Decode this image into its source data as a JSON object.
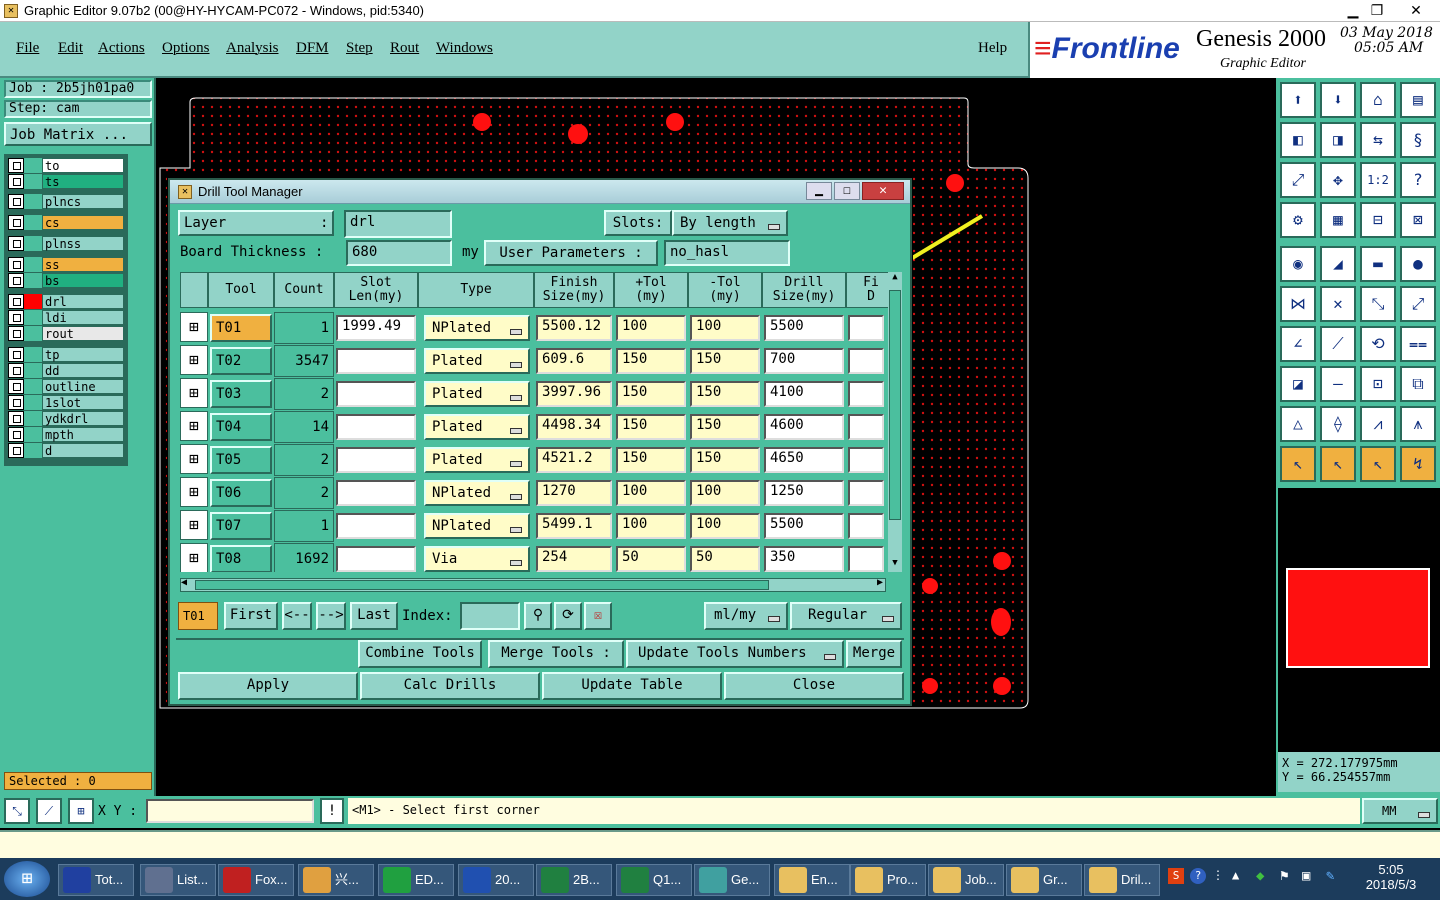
{
  "window": {
    "title": "Graphic Editor 9.07b2 (00@HY-HYCAM-PC072 - Windows, pid:5340)"
  },
  "menu": [
    "File",
    "Edit",
    "Actions",
    "Options",
    "Analysis",
    "DFM",
    "Step",
    "Rout",
    "Windows"
  ],
  "help": "Help",
  "brand": {
    "logo": "Frontline",
    "product": "Genesis 2000",
    "sub": "Graphic Editor",
    "date": "03 May 2018",
    "time": "05:05 AM"
  },
  "left": {
    "job": "Job : 2b5jh01pa0",
    "step": "Step: cam",
    "job_matrix": "Job Matrix ...",
    "selected": "Selected : 0",
    "layers": [
      {
        "name": "to",
        "color": "#ffffff"
      },
      {
        "name": "ts",
        "color": "#20b080"
      },
      {
        "name": "plncs",
        "color": "#92d3c8"
      },
      {
        "name": "cs",
        "color": "#f0b040"
      },
      {
        "name": "plnss",
        "color": "#92d3c8"
      },
      {
        "name": "ss",
        "color": "#f0b040"
      },
      {
        "name": "bs",
        "color": "#20b080"
      },
      {
        "name": "drl",
        "color": "#92d3c8"
      },
      {
        "name": "ldi",
        "color": "#92d3c8"
      },
      {
        "name": "rout",
        "color": "#e8e8e8"
      },
      {
        "name": "tp",
        "color": "#92d3c8"
      },
      {
        "name": "dd",
        "color": "#92d3c8"
      },
      {
        "name": "outline",
        "color": "#92d3c8"
      },
      {
        "name": "1slot",
        "color": "#92d3c8"
      },
      {
        "name": "ydkdrl",
        "color": "#92d3c8"
      },
      {
        "name": "mpth",
        "color": "#92d3c8"
      },
      {
        "name": "d",
        "color": "#92d3c8"
      }
    ]
  },
  "dialog": {
    "title": "Drill Tool Manager",
    "layer_label": "Layer",
    "layer_sep": ":",
    "layer_value": "drl",
    "slots_label": "Slots:",
    "slots_value": "By length",
    "thickness_label": "Board Thickness :",
    "thickness_value": "680",
    "thickness_unit": "my",
    "user_params_label": "User Parameters :",
    "user_params_value": "no_hasl",
    "columns": [
      "Tool",
      "Count",
      "Slot\nLen(my)",
      "Type",
      "Finish\nSize(my)",
      "+Tol\n(my)",
      "-Tol\n(my)",
      "Drill\nSize(my)",
      "Fi\nD"
    ],
    "rows": [
      {
        "tool": "T01",
        "count": "1",
        "slot": "1999.49",
        "type": "NPlated",
        "finish": "5500.12",
        "ptol": "100",
        "ntol": "100",
        "drill": "5500"
      },
      {
        "tool": "T02",
        "count": "3547",
        "slot": "",
        "type": "Plated",
        "finish": "609.6",
        "ptol": "150",
        "ntol": "150",
        "drill": "700"
      },
      {
        "tool": "T03",
        "count": "2",
        "slot": "",
        "type": "Plated",
        "finish": "3997.96",
        "ptol": "150",
        "ntol": "150",
        "drill": "4100"
      },
      {
        "tool": "T04",
        "count": "14",
        "slot": "",
        "type": "Plated",
        "finish": "4498.34",
        "ptol": "150",
        "ntol": "150",
        "drill": "4600"
      },
      {
        "tool": "T05",
        "count": "2",
        "slot": "",
        "type": "Plated",
        "finish": "4521.2",
        "ptol": "150",
        "ntol": "150",
        "drill": "4650"
      },
      {
        "tool": "T06",
        "count": "2",
        "slot": "",
        "type": "NPlated",
        "finish": "1270",
        "ptol": "100",
        "ntol": "100",
        "drill": "1250"
      },
      {
        "tool": "T07",
        "count": "1",
        "slot": "",
        "type": "NPlated",
        "finish": "5499.1",
        "ptol": "100",
        "ntol": "100",
        "drill": "5500"
      },
      {
        "tool": "T08",
        "count": "1692",
        "slot": "",
        "type": "Via",
        "finish": "254",
        "ptol": "50",
        "ntol": "50",
        "drill": "350"
      }
    ],
    "nav": {
      "current": "T01",
      "first": "First",
      "prev": "<--",
      "next": "-->",
      "last": "Last",
      "index": "Index:",
      "units": "ml/my",
      "mode": "Regular"
    },
    "actions": {
      "combine": "Combine Tools",
      "merge_tools": "Merge Tools :",
      "update_numbers": "Update Tools Numbers",
      "merge": "Merge"
    },
    "buttons": {
      "apply": "Apply",
      "calc": "Calc Drills",
      "update": "Update Table",
      "close": "Close"
    }
  },
  "coords": {
    "x": "X = 272.177975mm",
    "y": "Y = 66.254557mm"
  },
  "cmd": {
    "xy": "X Y :",
    "message": "<M1> - Select first corner",
    "unit": "MM"
  },
  "taskbar": {
    "items": [
      {
        "label": "Tot...",
        "color": "#2040a0"
      },
      {
        "label": "List...",
        "color": "#607090"
      },
      {
        "label": "Fox...",
        "color": "#c02020"
      },
      {
        "label": "兴...",
        "color": "#e0a040"
      },
      {
        "label": "ED...",
        "color": "#20a040"
      },
      {
        "label": "20...",
        "color": "#2050b0"
      },
      {
        "label": "2B...",
        "color": "#208040"
      },
      {
        "label": "Q1...",
        "color": "#208040"
      },
      {
        "label": "Ge...",
        "color": "#40a0a0"
      },
      {
        "label": "En...",
        "color": "#e8c060"
      },
      {
        "label": "Pro...",
        "color": "#e8c060"
      },
      {
        "label": "Job...",
        "color": "#e8c060"
      },
      {
        "label": "Gr...",
        "color": "#e8c060"
      },
      {
        "label": "Dril...",
        "color": "#e8c060"
      }
    ],
    "time": "5:05",
    "date": "2018/5/3"
  }
}
